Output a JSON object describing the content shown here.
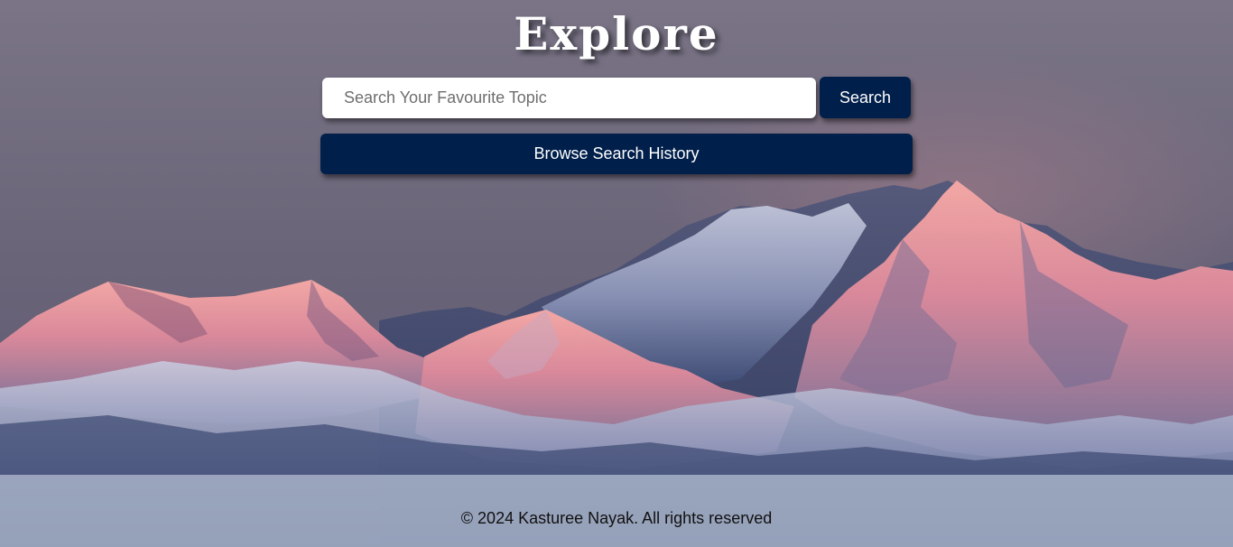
{
  "header": {
    "title": "Explore"
  },
  "search": {
    "placeholder": "Search Your Favourite Topic",
    "value": "",
    "button_label": "Search"
  },
  "history": {
    "button_label": "Browse Search History"
  },
  "footer": {
    "copyright": "© 2024 Kasturee Nayak. All rights reserved"
  },
  "colors": {
    "button_bg": "#001f4a",
    "button_text": "#ffffff",
    "input_bg": "#ffffff",
    "footer_bg": "#b8c4d6"
  },
  "background": {
    "image": "mountain-range-at-dusk"
  }
}
